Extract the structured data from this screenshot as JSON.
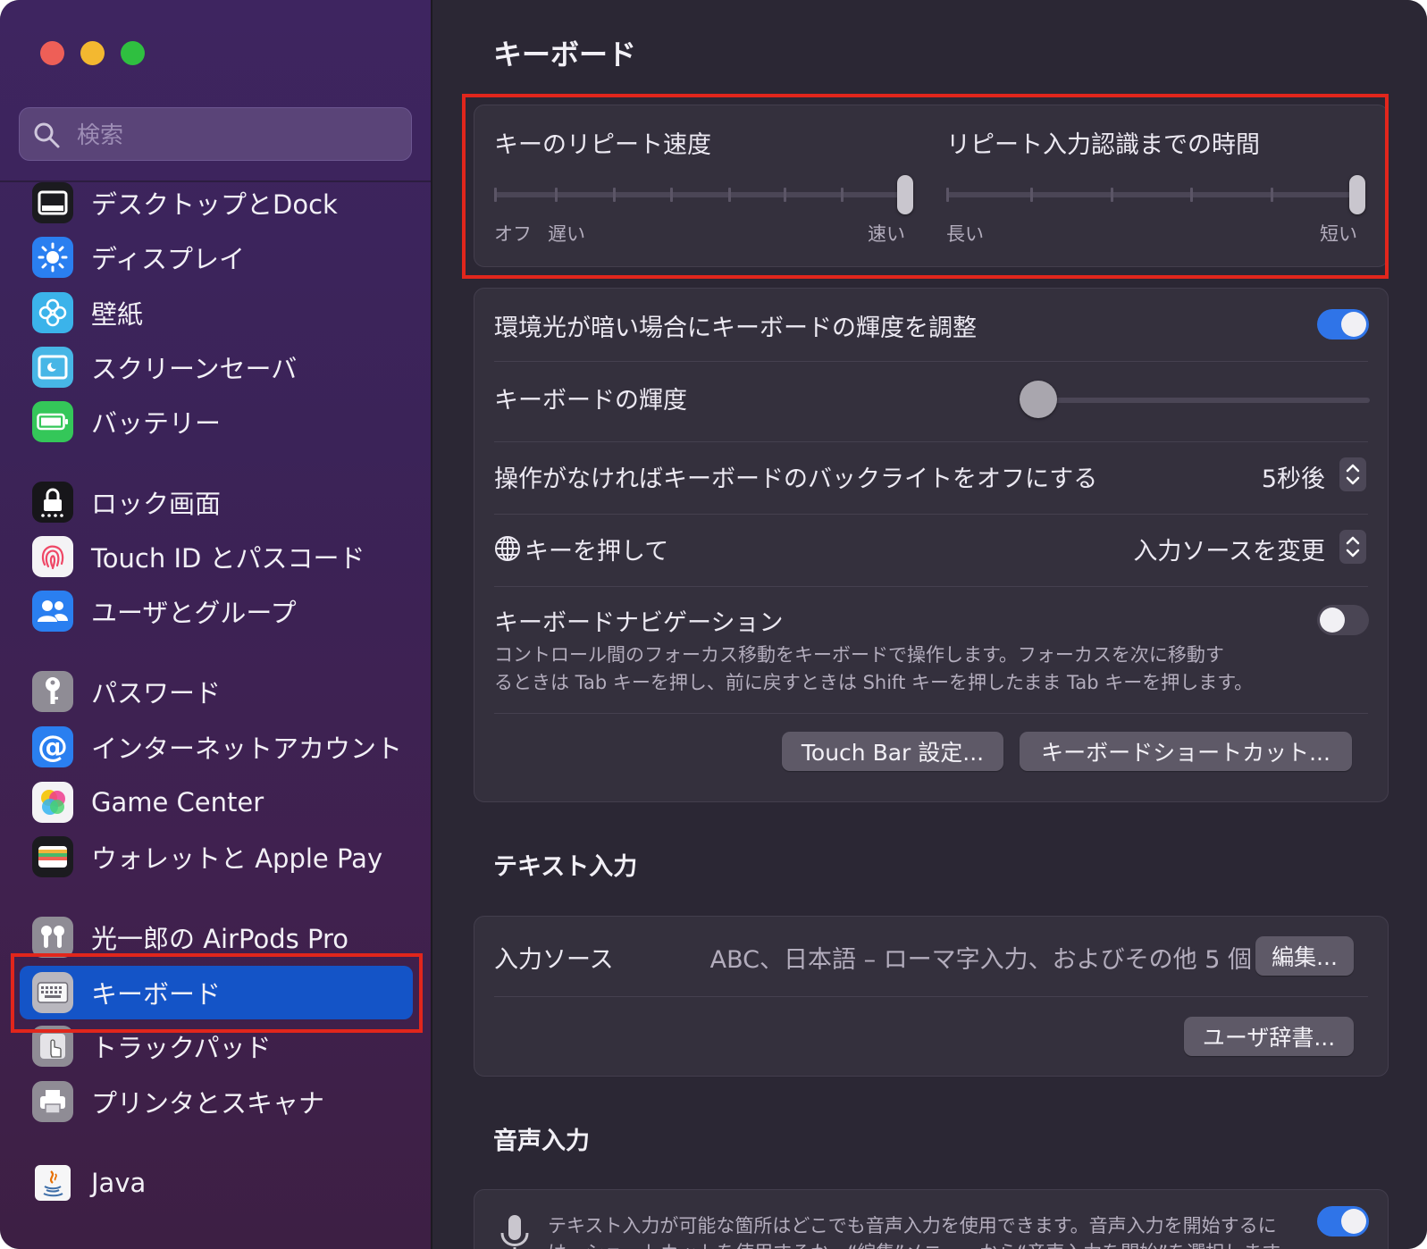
{
  "search": {
    "placeholder": "検索"
  },
  "sidebar": {
    "items": [
      {
        "label": "デスクトップとDock",
        "icon": "dock-icon"
      },
      {
        "label": "ディスプレイ",
        "icon": "display-icon"
      },
      {
        "label": "壁紙",
        "icon": "wallpaper-icon"
      },
      {
        "label": "スクリーンセーバ",
        "icon": "screensaver-icon"
      },
      {
        "label": "バッテリー",
        "icon": "battery-icon"
      },
      {
        "label": "ロック画面",
        "icon": "lock-icon"
      },
      {
        "label": "Touch ID とパスコード",
        "icon": "fingerprint-icon"
      },
      {
        "label": "ユーザとグループ",
        "icon": "users-icon"
      },
      {
        "label": "パスワード",
        "icon": "key-icon"
      },
      {
        "label": "インターネットアカウント",
        "icon": "at-icon"
      },
      {
        "label": "Game Center",
        "icon": "game-center-icon"
      },
      {
        "label": "ウォレットと Apple Pay",
        "icon": "wallet-icon"
      },
      {
        "label": "光一郎の AirPods Pro",
        "icon": "airpods-icon"
      },
      {
        "label": "キーボード",
        "icon": "keyboard-icon",
        "selected": true
      },
      {
        "label": "トラックパッド",
        "icon": "trackpad-icon"
      },
      {
        "label": "プリンタとスキャナ",
        "icon": "printer-icon"
      },
      {
        "label": "Java",
        "icon": "java-icon"
      }
    ]
  },
  "main": {
    "title": "キーボード",
    "repeat": {
      "speed_label": "キーのリピート速度",
      "speed_min": "オフ",
      "speed_slow": "遅い",
      "speed_fast": "速い",
      "speed_level": 1.0,
      "delay_label": "リピート入力認識までの時間",
      "delay_long": "長い",
      "delay_short": "短い",
      "delay_level": 1.0
    },
    "settings": {
      "ambient_label": "環境光が暗い場合にキーボードの輝度を調整",
      "ambient_on": true,
      "brightness_label": "キーボードの輝度",
      "brightness_level": 0.0,
      "backlight_label": "操作がなければキーボードのバックライトをオフにする",
      "backlight_value": "5秒後",
      "globe_label": "キーを押して",
      "globe_value": "入力ソースを変更",
      "nav_label": "キーボードナビゲーション",
      "nav_desc_1": "コントロール間のフォーカス移動をキーボードで操作します。フォーカスを次に移動す",
      "nav_desc_2": "るときは Tab キーを押し、前に戻すときは Shift キーを押したまま Tab キーを押します。",
      "nav_on": false,
      "touchbar_button": "Touch Bar 設定...",
      "shortcuts_button": "キーボードショートカット..."
    },
    "text_input": {
      "title": "テキスト入力",
      "source_label": "入力ソース",
      "source_value": "ABC、日本語 – ローマ字入力、およびその他 5 個",
      "edit_button": "編集...",
      "dictionary_button": "ユーザ辞書..."
    },
    "dictation": {
      "title": "音声入力",
      "desc_1": "テキスト入力が可能な箇所はどこでも音声入力を使用できます。音声入力を開始するに",
      "desc_2": "は、ショートカットを使用するか、“編集”メニューから“音声入力を開始”を選択します。",
      "on": true
    }
  },
  "colors": {
    "accent": "#2f74e8",
    "selection": "#1454c7",
    "highlight_box": "#e1261c"
  }
}
